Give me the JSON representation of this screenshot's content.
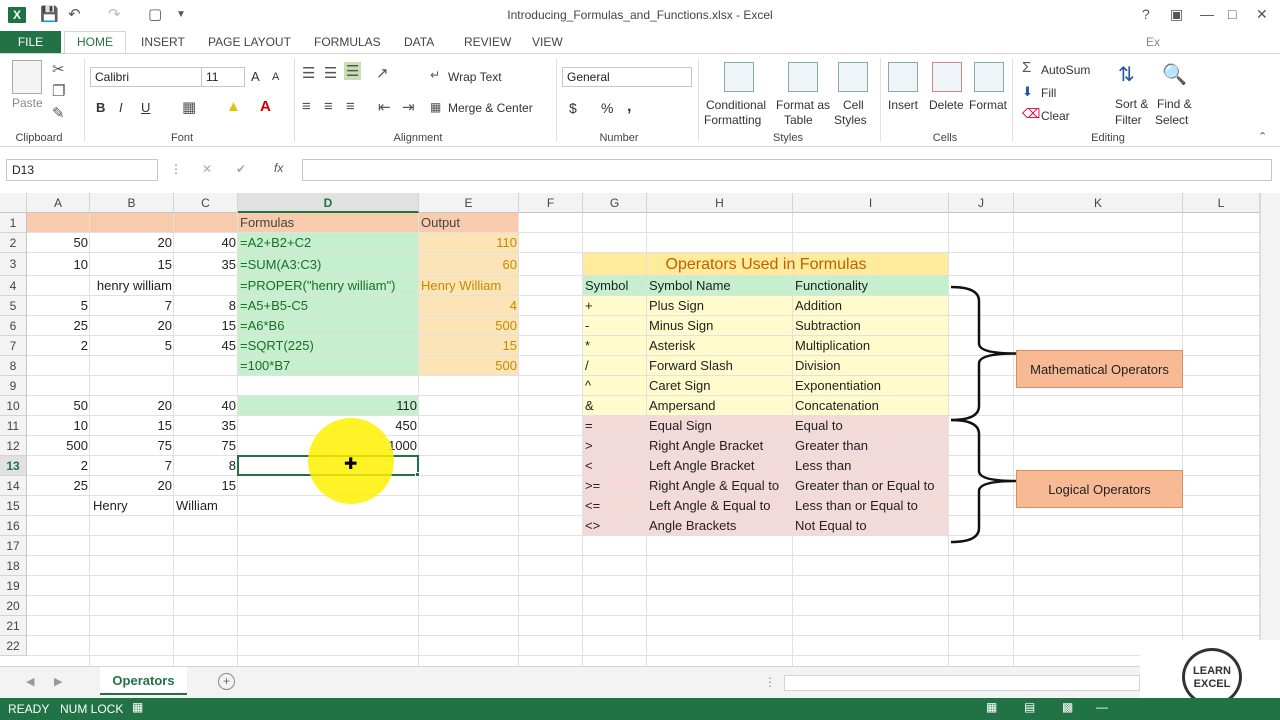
{
  "app": {
    "window_title": "Introducing_Formulas_and_Functions.xlsx - Excel",
    "logo": "X",
    "help": "?",
    "account": "Ex"
  },
  "tabs": [
    "FILE",
    "HOME",
    "INSERT",
    "PAGE LAYOUT",
    "FORMULAS",
    "DATA",
    "REVIEW",
    "VIEW"
  ],
  "ribbon": {
    "clipboard": {
      "label": "Clipboard",
      "paste": "Paste"
    },
    "font": {
      "label": "Font",
      "name": "Calibri",
      "size": "11",
      "bold": "B",
      "italic": "I",
      "underline": "U",
      "grow": "A",
      "shrink": "A"
    },
    "alignment": {
      "label": "Alignment",
      "wrap": "Wrap Text",
      "merge": "Merge & Center"
    },
    "number": {
      "label": "Number",
      "format": "General",
      "currency": "$",
      "percent": "%",
      "comma": ","
    },
    "styles": {
      "label": "Styles",
      "cond1": "Conditional",
      "cond2": "Formatting",
      "table1": "Format as",
      "table2": "Table",
      "cell1": "Cell",
      "cell2": "Styles"
    },
    "cells": {
      "label": "Cells",
      "insert": "Insert",
      "delete": "Delete",
      "format": "Format"
    },
    "editing": {
      "label": "Editing",
      "autosum": "AutoSum",
      "fill": "Fill",
      "clear": "Clear",
      "sort1": "Sort &",
      "sort2": "Filter",
      "find1": "Find &",
      "find2": "Select"
    }
  },
  "formula_bar": {
    "name_box": "D13",
    "fx": "fx",
    "cancel": "✕",
    "enter": "✔",
    "content": ""
  },
  "columns": [
    "A",
    "B",
    "C",
    "D",
    "E",
    "F",
    "G",
    "H",
    "I",
    "J",
    "K",
    "L"
  ],
  "rows": [
    "1",
    "2",
    "3",
    "4",
    "5",
    "6",
    "7",
    "8",
    "9",
    "10",
    "11",
    "12",
    "13",
    "14",
    "15",
    "16",
    "17",
    "18",
    "19",
    "20",
    "21",
    "22"
  ],
  "cells": {
    "D1": "Formulas",
    "E1": "Output",
    "A2": "50",
    "B2": "20",
    "C2": "40",
    "D2": "=A2+B2+C2",
    "E2": "110",
    "A3": "10",
    "B3": "15",
    "C3": "35",
    "D3": "=SUM(A3:C3)",
    "E3": "60",
    "B4": "henry william",
    "D4": "=PROPER(\"henry william\")",
    "E4": "Henry William",
    "A5": "5",
    "B5": "7",
    "C5": "8",
    "D5": "=A5+B5-C5",
    "E5": "4",
    "A6": "25",
    "B6": "20",
    "C6": "15",
    "D6": "=A6*B6",
    "E6": "500",
    "A7": "2",
    "B7": "5",
    "C7": "45",
    "D7": "=SQRT(225)",
    "E7": "15",
    "D8": "=100*B7",
    "E8": "500",
    "A10": "50",
    "B10": "20",
    "C10": "40",
    "D10": "110",
    "A11": "10",
    "B11": "15",
    "C11": "35",
    "D11": "450",
    "A12": "500",
    "B12": "75",
    "C12": "75",
    "D12": "1000",
    "A13": "2",
    "B13": "7",
    "C13": "8",
    "A14": "25",
    "B14": "20",
    "C14": "15",
    "B15": "Henry",
    "C15": "William"
  },
  "operators_table": {
    "title": "Operators Used in Formulas",
    "headers": [
      "Symbol",
      "Symbol Name",
      "Functionality"
    ],
    "rows": [
      [
        "+",
        "Plus Sign",
        "Addition"
      ],
      [
        "-",
        "Minus Sign",
        "Subtraction"
      ],
      [
        "*",
        "Asterisk",
        "Multiplication"
      ],
      [
        "/",
        "Forward Slash",
        "Division"
      ],
      [
        "^",
        "Caret Sign",
        "Exponentiation"
      ],
      [
        "&",
        "Ampersand",
        "Concatenation"
      ],
      [
        "=",
        "Equal Sign",
        "Equal to"
      ],
      [
        ">",
        "Right Angle Bracket",
        "Greater than"
      ],
      [
        "<",
        "Left Angle Bracket",
        "Less than"
      ],
      [
        ">=",
        "Right Angle & Equal to",
        "Greater than or Equal to"
      ],
      [
        "<=",
        "Left Angle & Equal to",
        "Less than or Equal to"
      ],
      [
        "<>",
        "Angle Brackets",
        "Not Equal to"
      ]
    ],
    "math_label": "Mathematical Operators",
    "logical_label": "Logical Operators"
  },
  "sheet_tabs": [
    "Operators"
  ],
  "status": {
    "ready": "READY",
    "numlock": "NUM LOCK"
  },
  "logo_text": [
    "LEARN",
    "EXCEL"
  ],
  "colors": {
    "excel_green": "#217346",
    "header_orange": "#f8cbad",
    "formula_green": "#c6efce",
    "output_orange": "#fce4b6",
    "title_yellow": "#ffeb9c",
    "op_yellow": "#fffbcc",
    "op_red": "#f4d9d9",
    "label_orange": "#f8b995"
  }
}
